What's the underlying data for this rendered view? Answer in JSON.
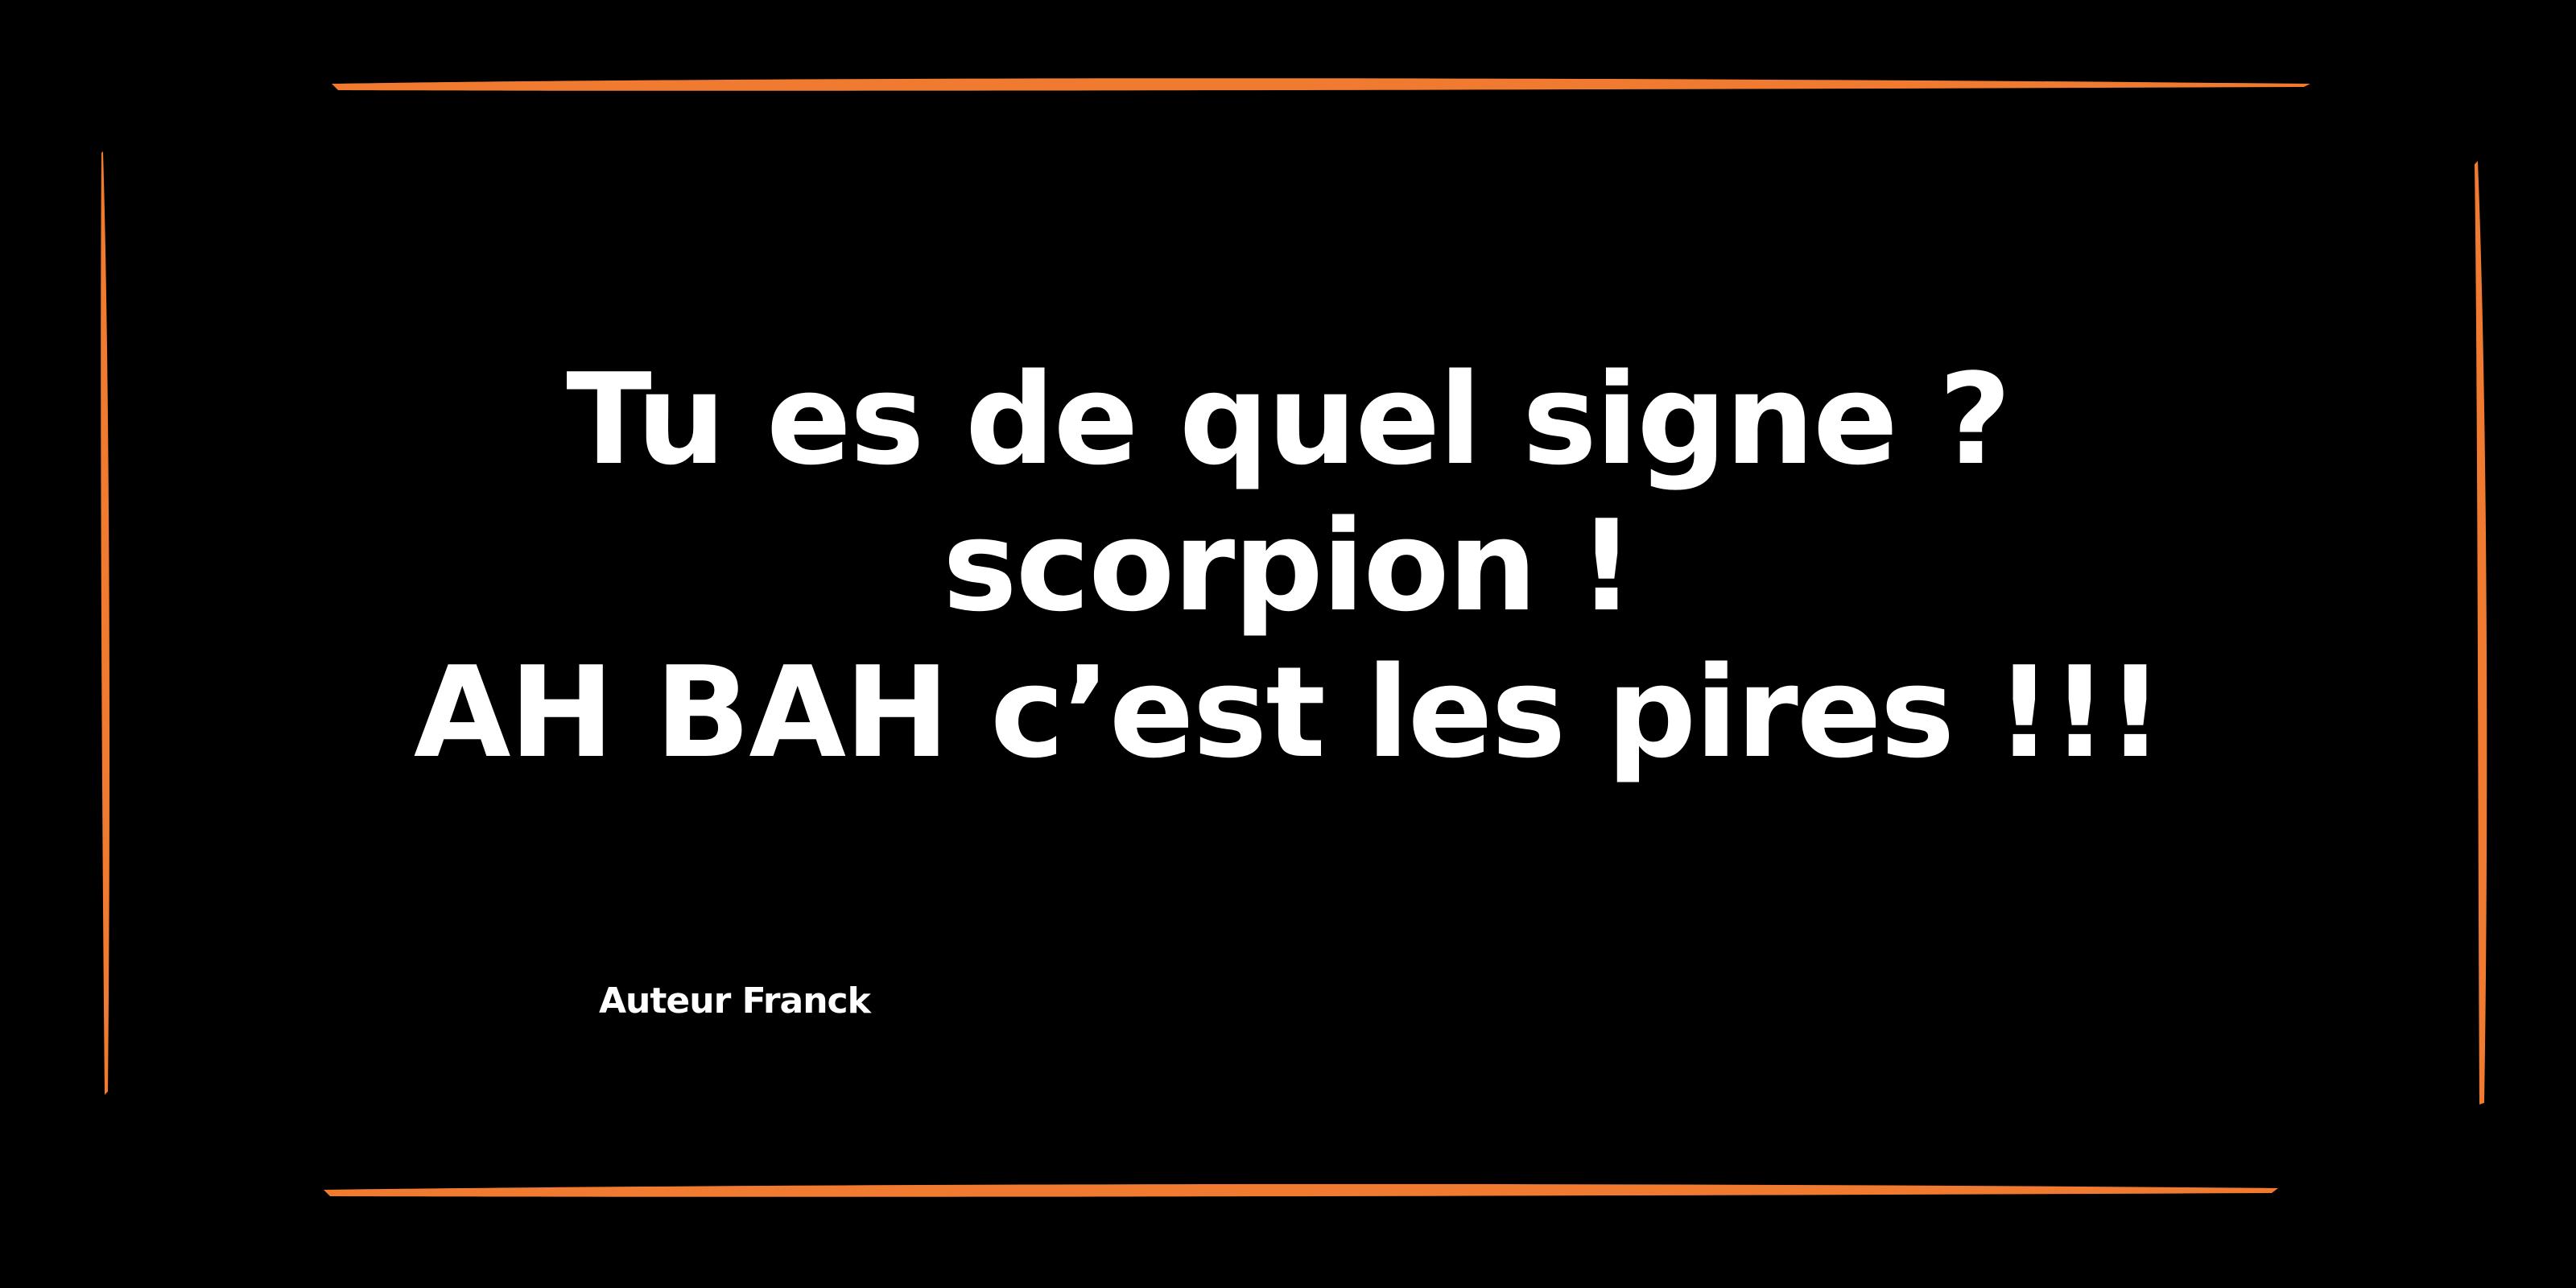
{
  "colors": {
    "background": "#000000",
    "text": "#ffffff",
    "frame_stroke": "#f07a30"
  },
  "quote": {
    "lines": [
      "Tu es de quel signe ?",
      "scorpion !",
      "AH BAH c’est les pires !!!"
    ]
  },
  "author": {
    "label": "Auteur Franck"
  }
}
